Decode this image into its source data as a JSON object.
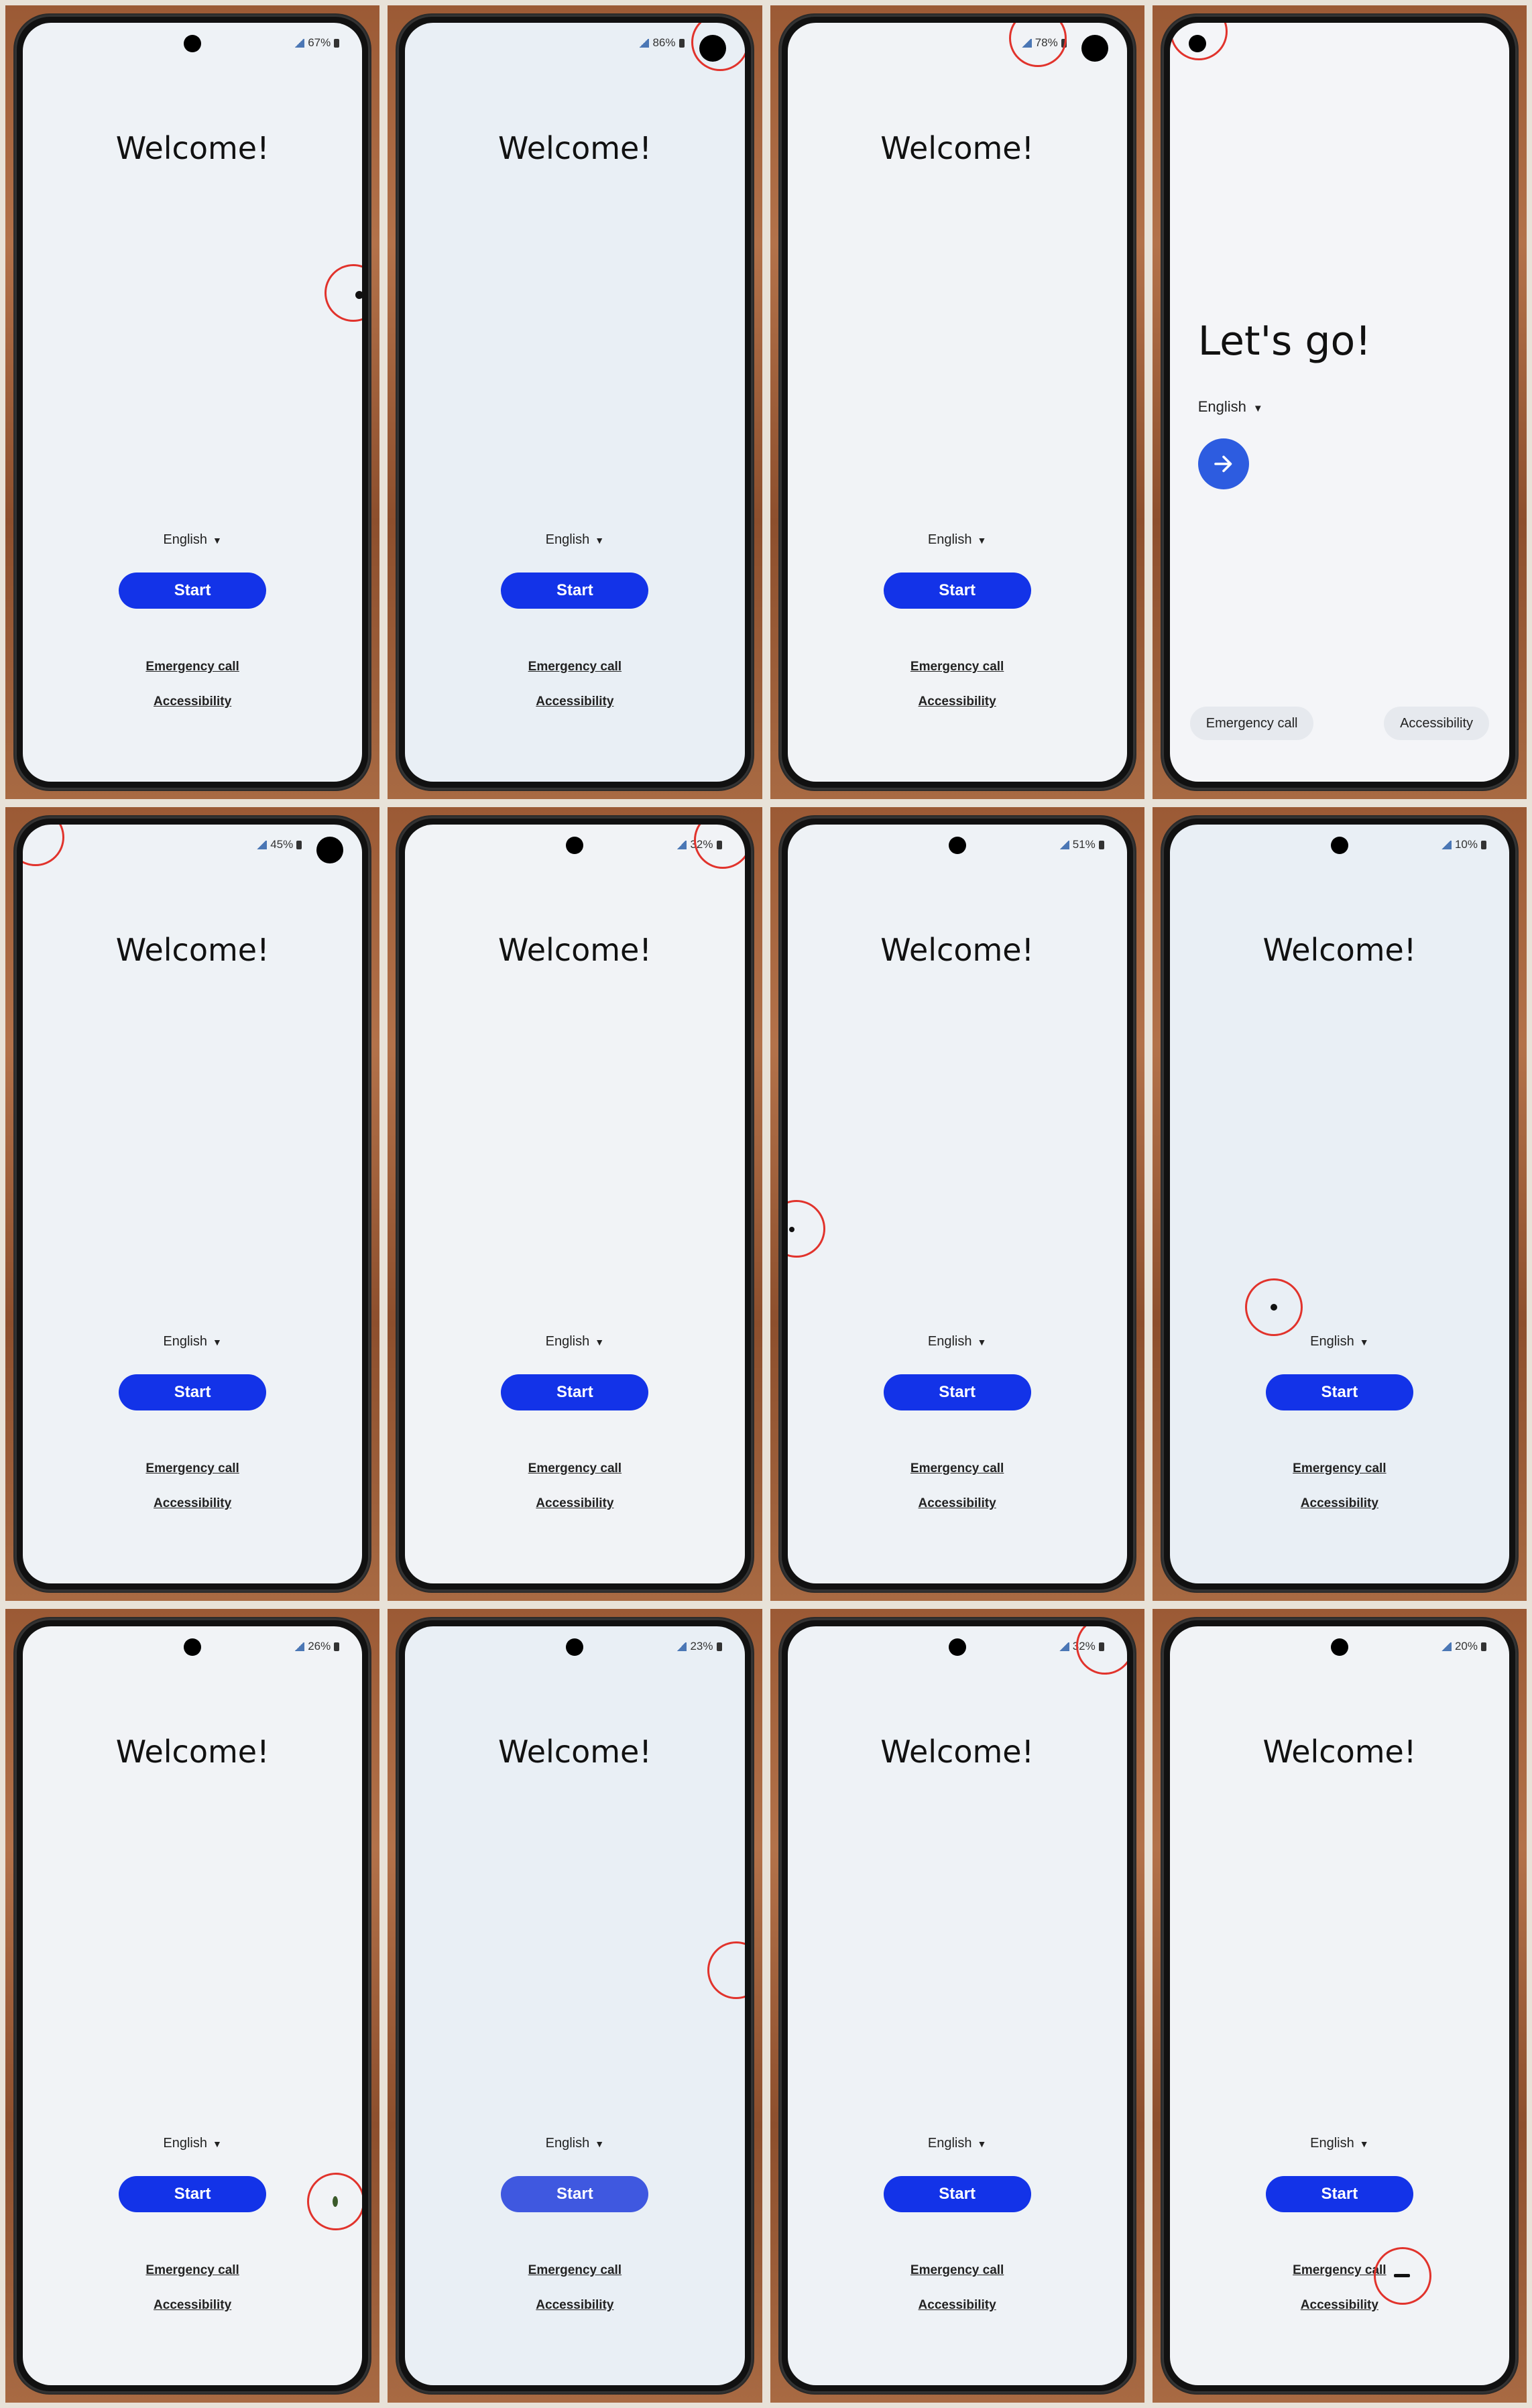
{
  "common": {
    "welcome_title": "Welcome!",
    "language": "English",
    "start_label": "Start",
    "emergency_label": "Emergency call",
    "accessibility_label": "Accessibility"
  },
  "variant_letsgo": {
    "title": "Let's go!",
    "language": "English",
    "emergency_label": "Emergency call",
    "accessibility_label": "Accessibility"
  },
  "phones": [
    {
      "battery": "67%"
    },
    {
      "battery": "86%"
    },
    {
      "battery": "78%"
    },
    {
      "battery": ""
    },
    {
      "battery": "45%"
    },
    {
      "battery": "32%"
    },
    {
      "battery": "51%"
    },
    {
      "battery": "10%"
    },
    {
      "battery": "26%"
    },
    {
      "battery": "23%"
    },
    {
      "battery": "32%"
    },
    {
      "battery": "20%"
    }
  ],
  "colors": {
    "start_button": "#1333e8",
    "start_button_light": "#3f58e0",
    "arrow_button": "#2d5ce0",
    "defect_marker": "#e1332c"
  },
  "icons": {
    "arrow": "arrow-right-icon",
    "caret": "caret-down-icon",
    "battery": "battery-icon",
    "signal": "signal-icon"
  }
}
